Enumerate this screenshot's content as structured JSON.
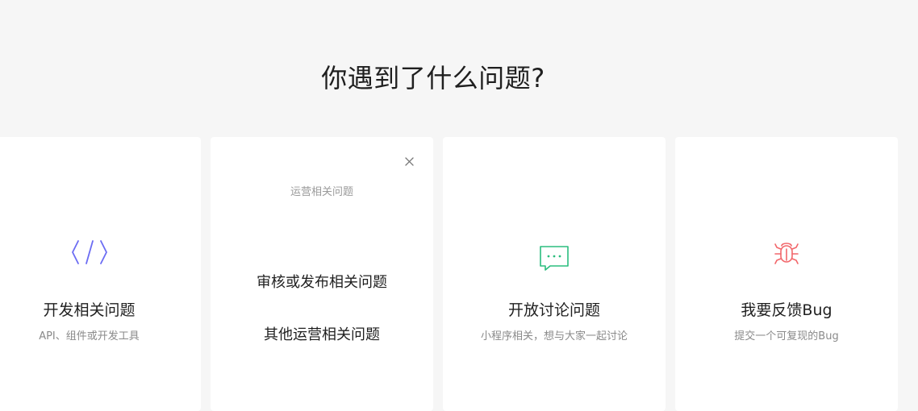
{
  "page": {
    "heading": "你遇到了什么问题?"
  },
  "colors": {
    "dev_icon": "#6b6cf3",
    "discuss_icon": "#2bbd7e",
    "bug_icon": "#f2676b",
    "background": "#f6f6f6",
    "card": "#ffffff"
  },
  "cards": [
    {
      "id": "dev",
      "icon": "code-icon",
      "title": "开发相关问题",
      "desc": "API、组件或开发工具"
    },
    {
      "id": "ops",
      "icon": "close-icon",
      "header": "运营相关问题",
      "options": [
        "审核或发布相关问题",
        "其他运营相关问题"
      ]
    },
    {
      "id": "discuss",
      "icon": "chat-icon",
      "title": "开放讨论问题",
      "desc": "小程序相关，想与大家一起讨论"
    },
    {
      "id": "bug",
      "icon": "bug-icon",
      "title": "我要反馈Bug",
      "desc": "提交一个可复现的Bug"
    }
  ]
}
